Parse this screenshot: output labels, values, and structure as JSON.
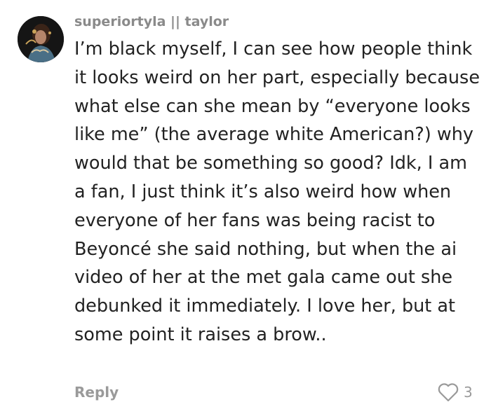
{
  "comment": {
    "username": "superiortyla || taylor",
    "text": "I’m black myself, I can see how people think it looks weird on her part, especially because what else can she mean by “everyone looks like me” (the average white American?) why would that be something so good? Idk, I am a fan, I just think it’s also weird how when everyone of her fans was being racist to Beyoncé she said nothing, but when the ai video of her at the met gala came out she debunked it immediately. I love her, but at some point it raises a brow..",
    "reply_label": "Reply",
    "like_count": "3",
    "like_icon": "heart-outline-icon"
  },
  "colors": {
    "username": "#8a8a8a",
    "body_text": "#222222",
    "meta_text": "#9a9a9a"
  }
}
